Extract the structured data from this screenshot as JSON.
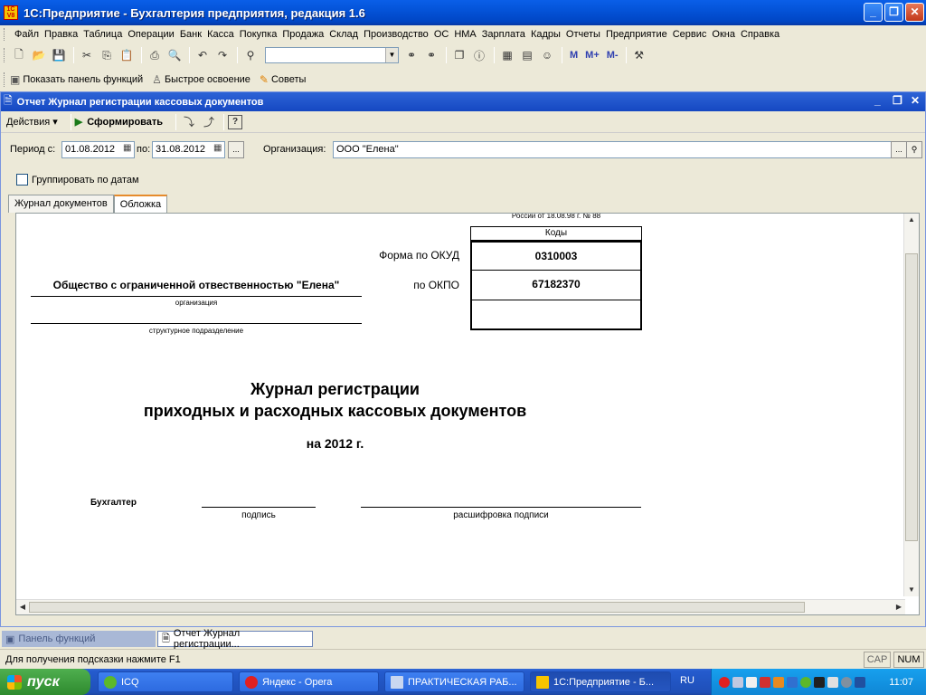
{
  "window": {
    "title": "1С:Предприятие - Бухгалтерия предприятия, редакция 1.6",
    "icon_text": "1C V8",
    "controls": [
      "_",
      "❐",
      "✕"
    ]
  },
  "menu": [
    "Файл",
    "Правка",
    "Таблица",
    "Операции",
    "Банк",
    "Касса",
    "Покупка",
    "Продажа",
    "Склад",
    "Производство",
    "ОС",
    "НМА",
    "Зарплата",
    "Кадры",
    "Отчеты",
    "Предприятие",
    "Сервис",
    "Окна",
    "Справка"
  ],
  "toolbar2": {
    "show_panel": "Показать панель функций",
    "quick_learn": "Быстрое освоение",
    "tips": "Советы"
  },
  "memory_buttons": [
    "M",
    "M+",
    "M-"
  ],
  "document": {
    "title": "Отчет Журнал регистрации кассовых документов",
    "actions_label": "Действия",
    "generate_label": "Сформировать",
    "help_label": "?",
    "period_from_label": "Период с:",
    "period_from": "01.08.2012",
    "period_to_label": "по:",
    "period_to": "31.08.2012",
    "ellipsis": "...",
    "org_label": "Организация:",
    "org_value": "ООО \"Елена\"",
    "group_by_dates_label": "Группировать по датам",
    "group_by_dates_checked": false,
    "tabs": [
      "Журнал документов",
      "Обложка"
    ],
    "active_tab": "Обложка"
  },
  "report": {
    "top_fragment": "России от 18.08.98 г. № 88",
    "codes_header": "Коды",
    "okud_label": "Форма по ОКУД",
    "okud_value": "0310003",
    "okpo_label": "по ОКПО",
    "okpo_value": "67182370",
    "organization_name": "Общество с ограниченной отвественностью \"Елена\"",
    "organization_caption": "организация",
    "department_caption": "структурное подразделение",
    "title_line1": "Журнал регистрации",
    "title_line2": "приходных и расходных кассовых документов",
    "year_line": "на 2012 г.",
    "accountant_label": "Бухгалтер",
    "signature_caption": "подпись",
    "signature_decode_caption": "расшифровка подписи"
  },
  "mdi_tabs": [
    "Панель функций",
    "Отчет Журнал регистрации..."
  ],
  "status": {
    "hint": "Для получения подсказки нажмите F1",
    "cap": "CAP",
    "num": "NUM"
  },
  "taskbar": {
    "start_label": "пуск",
    "tasks": [
      "ICQ",
      "Яндекс - Opera",
      "ПРАКТИЧЕСКАЯ РАБ...",
      "1С:Предприятие - Б..."
    ],
    "lang": "RU",
    "clock": "11:07"
  }
}
